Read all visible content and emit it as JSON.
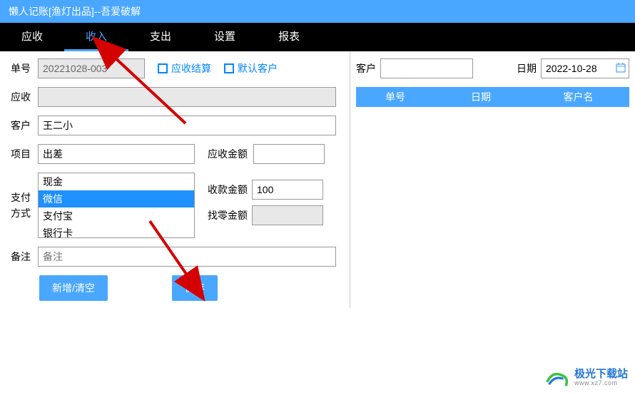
{
  "window_title": "懒人记账[渔灯出品]--吾爱破解",
  "menu": {
    "items": [
      {
        "label": "应收"
      },
      {
        "label": "收入"
      },
      {
        "label": "支出"
      },
      {
        "label": "设置"
      },
      {
        "label": "报表"
      }
    ],
    "active_index": 1
  },
  "form": {
    "bill_no_label": "单号",
    "bill_no_value": "20221028-003",
    "checkbox_settle": "应收结算",
    "checkbox_default_customer": "默认客户",
    "receivable_label": "应收",
    "receivable_value": "",
    "customer_label": "客户",
    "customer_value": "王二小",
    "project_label": "项目",
    "project_value": "出差",
    "receivable_amount_label": "应收金额",
    "receivable_amount_value": "",
    "pay_method_label_1": "支付",
    "pay_method_label_2": "方式",
    "pay_options": [
      "现金",
      "微信",
      "支付宝",
      "银行卡"
    ],
    "pay_selected_index": 1,
    "receive_amount_label": "收款金额",
    "receive_amount_value": "100",
    "change_amount_label": "找零金额",
    "change_amount_value": "",
    "remark_label": "备注",
    "remark_placeholder": "备注",
    "remark_value": "",
    "btn_new": "新增/清空",
    "btn_save": "保存"
  },
  "right": {
    "customer_label": "客户",
    "customer_value": "",
    "date_label": "日期",
    "date_value": "2022-10-28",
    "table_headers": [
      "单号",
      "日期",
      "客户名"
    ]
  },
  "watermark": {
    "cn": "极光下载站",
    "en": "www.xz7.com"
  }
}
